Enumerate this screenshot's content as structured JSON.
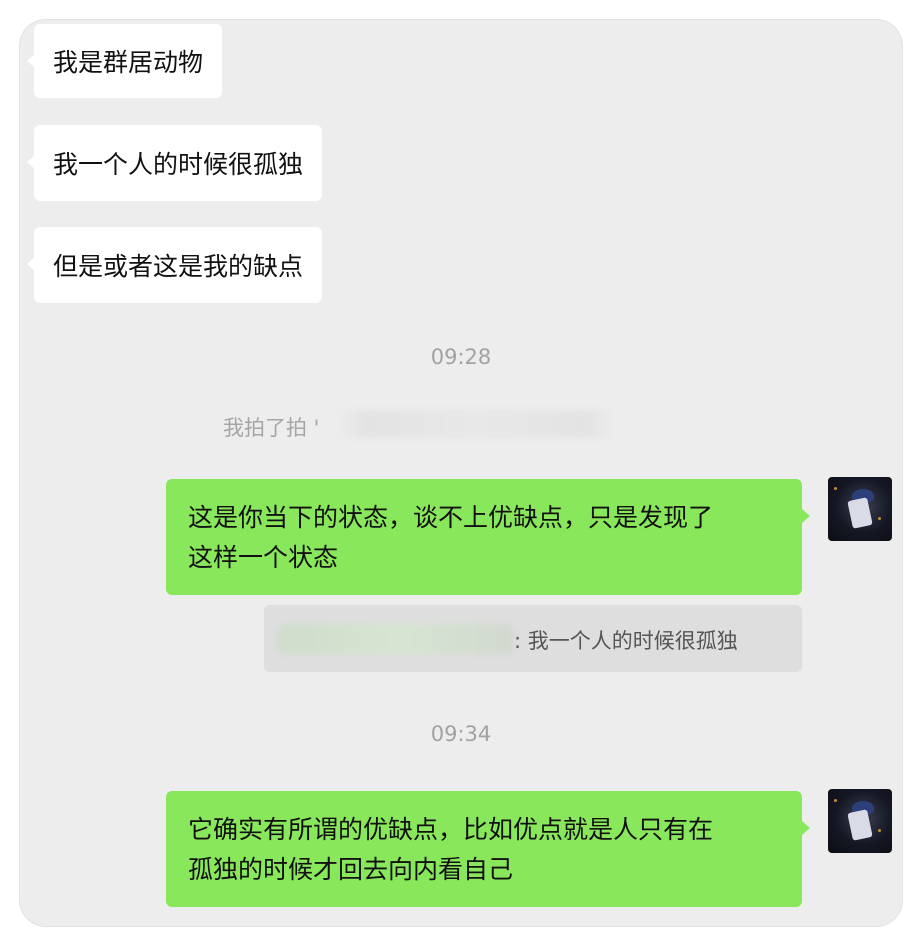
{
  "messages_in": [
    {
      "text": "我是群居动物"
    },
    {
      "text": "我一个人的时候很孤独"
    },
    {
      "text": "但是或者这是我的缺点"
    }
  ],
  "timestamps": [
    "09:28",
    "09:34"
  ],
  "system_notice": "我拍了拍 '",
  "messages_out": [
    {
      "lines": [
        "这是你当下的状态，谈不上优缺点，只是发现了",
        "这样一个状态"
      ]
    },
    {
      "lines": [
        "它确实有所谓的优缺点，比如优点就是人只有在",
        "孤独的时候才回去向内看自己"
      ]
    }
  ],
  "quote": {
    "text": ": 我一个人的时候很孤独"
  },
  "colors": {
    "background": "#ededed",
    "incoming_bubble": "#ffffff",
    "outgoing_bubble": "#89e75b",
    "quote_bg": "#dedede"
  }
}
